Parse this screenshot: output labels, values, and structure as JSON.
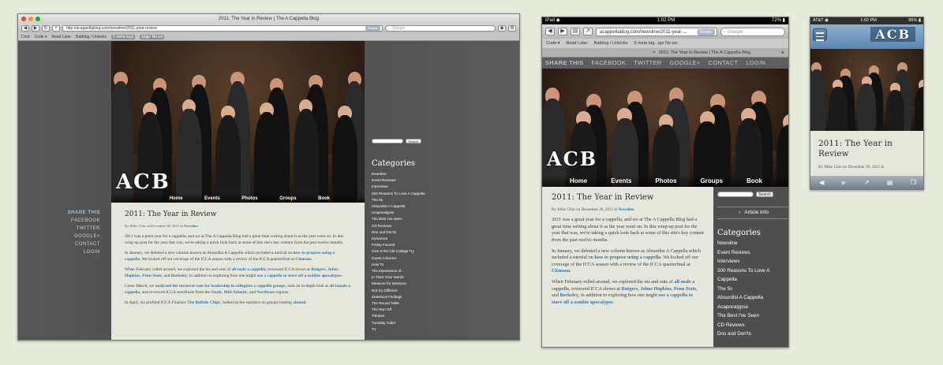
{
  "shared": {
    "post_title": "2011: The Year in Review",
    "byline_prefix": "By Mike Chin on December 26, 2011 in",
    "byline_category": "Newsline",
    "search_button": "Search",
    "categories_heading": "Categories",
    "nav": [
      "Home",
      "Events",
      "Photos",
      "Groups",
      "Book"
    ],
    "logo": "ACB"
  },
  "desktop": {
    "window_title": "2011: The Year in Review | The A Cappella Blog",
    "url": "http://acappellablog.com/newsline/2011-year-review",
    "reader_label": "Reader",
    "search_placeholder": "Google",
    "bookmarks": [
      "Cmd",
      "Code ▾",
      "Read Later",
      "Batblog / Unlocks",
      "5 meta tags",
      "esign Ne.ws"
    ],
    "share": [
      "SHARE THIS",
      "FACEBOOK",
      "TWITTER",
      "GOOGLE+",
      "CONTACT",
      "LOGIN"
    ],
    "categories": [
      "Newsline",
      "Event Reviews",
      "Interviews",
      "200 Reasons To Love A Cappella",
      "The 5s",
      "Absurdist A Cappella",
      "Acapocalypse",
      "The Best I've Seen",
      "CD Reviews",
      "Dos and Don'ts",
      "Dynamics",
      "Friday Factoid",
      "Give It the Old College Try",
      "Guest Columns",
      "How To",
      "The Importance of...",
      "In Their Own Words",
      "Measure for Measure",
      "Not So Different",
      "Statistical Findings",
      "The Round Table",
      "The Run Off",
      "Tributes",
      "Tuesday Tubin'",
      "TV"
    ],
    "paragraphs": [
      {
        "parts": [
          {
            "t": "2011 was a great year for a cappella, and we at The A Cappella Blog had a great time writing about it as the year went on. In this wrap-up post for the year that was, we're taking a quick look back at some of this site's key content from the past twelve months.",
            "l": false
          }
        ]
      },
      {
        "parts": [
          {
            "t": "In January, we debuted a new column known as Absurdist A Cappella which included a tutorial on ",
            "l": false
          },
          {
            "t": "how to propose using a cappella",
            "l": true
          },
          {
            "t": ". We kicked off our coverage of the ICCA season with a review of the ICCA quarterfinal at ",
            "l": false
          },
          {
            "t": "Clemson",
            "l": true
          },
          {
            "t": ".",
            "l": false
          }
        ]
      },
      {
        "parts": [
          {
            "t": "When February rolled around, we explored the ins and outs of ",
            "l": false
          },
          {
            "t": "all-male a cappella",
            "l": true
          },
          {
            "t": ", reviewed ICCA shows at ",
            "l": false
          },
          {
            "t": "Rutgers",
            "l": true
          },
          {
            "t": ", ",
            "l": false
          },
          {
            "t": "Johns Hopkins",
            "l": true
          },
          {
            "t": ", ",
            "l": false
          },
          {
            "t": "Penn State",
            "l": true
          },
          {
            "t": ", and ",
            "l": false
          },
          {
            "t": "Berkeley",
            "l": true
          },
          {
            "t": ", in addition to exploring how one might ",
            "l": false
          },
          {
            "t": "use a cappella to stave off a zombie apocalypse",
            "l": true
          },
          {
            "t": ".",
            "l": false
          }
        ]
      },
      {
        "parts": [
          {
            "t": "Come March, we ",
            "l": false
          },
          {
            "t": "analyzed the turnover rate for leadership in collegiate a cappella groups",
            "l": true
          },
          {
            "t": ", took an in-depth look at ",
            "l": false
          },
          {
            "t": "all-female a cappella",
            "l": true
          },
          {
            "t": ", and reviewed ICCA semifinals from the ",
            "l": false
          },
          {
            "t": "South",
            "l": true
          },
          {
            "t": ", ",
            "l": false
          },
          {
            "t": "Mid-Atlantic",
            "l": true
          },
          {
            "t": ", and ",
            "l": false
          },
          {
            "t": "Northeast",
            "l": true
          },
          {
            "t": " regions.",
            "l": false
          }
        ]
      },
      {
        "parts": [
          {
            "t": "In April, we profiled ICCA Finalists ",
            "l": false
          },
          {
            "t": "The Buffalo Chips",
            "l": true
          },
          {
            "t": ", looked at the statistics on groups hosting ",
            "l": false
          },
          {
            "t": "alumni",
            "l": true
          }
        ]
      }
    ]
  },
  "ipad": {
    "status_left": "iPad ◉",
    "status_time": "1:02 PM",
    "status_right": "72% ▮",
    "url": "acappellablog.com/newsline/2011-year-...",
    "reader_label": "Reader",
    "search_placeholder": "Google",
    "bookmarks": [
      "Code ▾",
      "Read Later",
      "Batblog / Unlocks",
      "5 meta tag...ign Ne.ws"
    ],
    "tab_title": "2011: The Year in Review | The A Cappella Blog",
    "share": [
      "SHARE THIS",
      "FACEBOOK",
      "TWITTER",
      "GOOGLE+",
      "CONTACT",
      "LOGIN"
    ],
    "article_info": "Article Info",
    "categories": [
      "Newsline",
      "Event Reviews",
      "Interviews",
      "200 Reasons To Love A Cappella",
      "The 5s",
      "Absurdist A Cappella",
      "Acapocalypse",
      "The Best I've Seen",
      "CD Reviews",
      "Dos and Don'ts"
    ],
    "paragraphs": [
      {
        "parts": [
          {
            "t": "2011 was a great year for a cappella, and we at The A Cappella Blog had a great time writing about it as the year went on. In this wrap-up post for the year that was, we're taking a quick look back at some of this site's key content from the past twelve months.",
            "l": false
          }
        ]
      },
      {
        "parts": [
          {
            "t": "In January, we debuted a new column known as Absurdist A Cappella which included a tutorial on ",
            "l": false
          },
          {
            "t": "how to propose using a cappella",
            "l": true
          },
          {
            "t": ". We kicked off our coverage of the ICCA season with a review of the ICCA quarterfinal at ",
            "l": false
          },
          {
            "t": "Clemson",
            "l": true
          },
          {
            "t": ".",
            "l": false
          }
        ]
      },
      {
        "parts": [
          {
            "t": "When February rolled around, we explored the ins and outs of ",
            "l": false
          },
          {
            "t": "all-male a cappella",
            "l": true
          },
          {
            "t": ", reviewed ICCA shows at ",
            "l": false
          },
          {
            "t": "Rutgers",
            "l": true
          },
          {
            "t": ", ",
            "l": false
          },
          {
            "t": "Johns Hopkins",
            "l": true
          },
          {
            "t": ", ",
            "l": false
          },
          {
            "t": "Penn State",
            "l": true
          },
          {
            "t": ", and ",
            "l": false
          },
          {
            "t": "Berkeley",
            "l": true
          },
          {
            "t": ", in addition to exploring how one might ",
            "l": false
          },
          {
            "t": "use a cappella to stave off a zombie apocalypse",
            "l": true
          },
          {
            "t": ".",
            "l": false
          }
        ]
      }
    ]
  },
  "iphone": {
    "status_left": "AT&T ◉",
    "status_time": "1:02 PM",
    "status_right": "85% ▮",
    "byline": "By Mike Chin on December 26, 2011 in"
  },
  "colors": {
    "background": "#e6ebdc",
    "link": "#3a73a8",
    "article_bg": "#e6e7dc",
    "tie_red": "#c4162a",
    "share_highlight": "#a9c0e0"
  }
}
